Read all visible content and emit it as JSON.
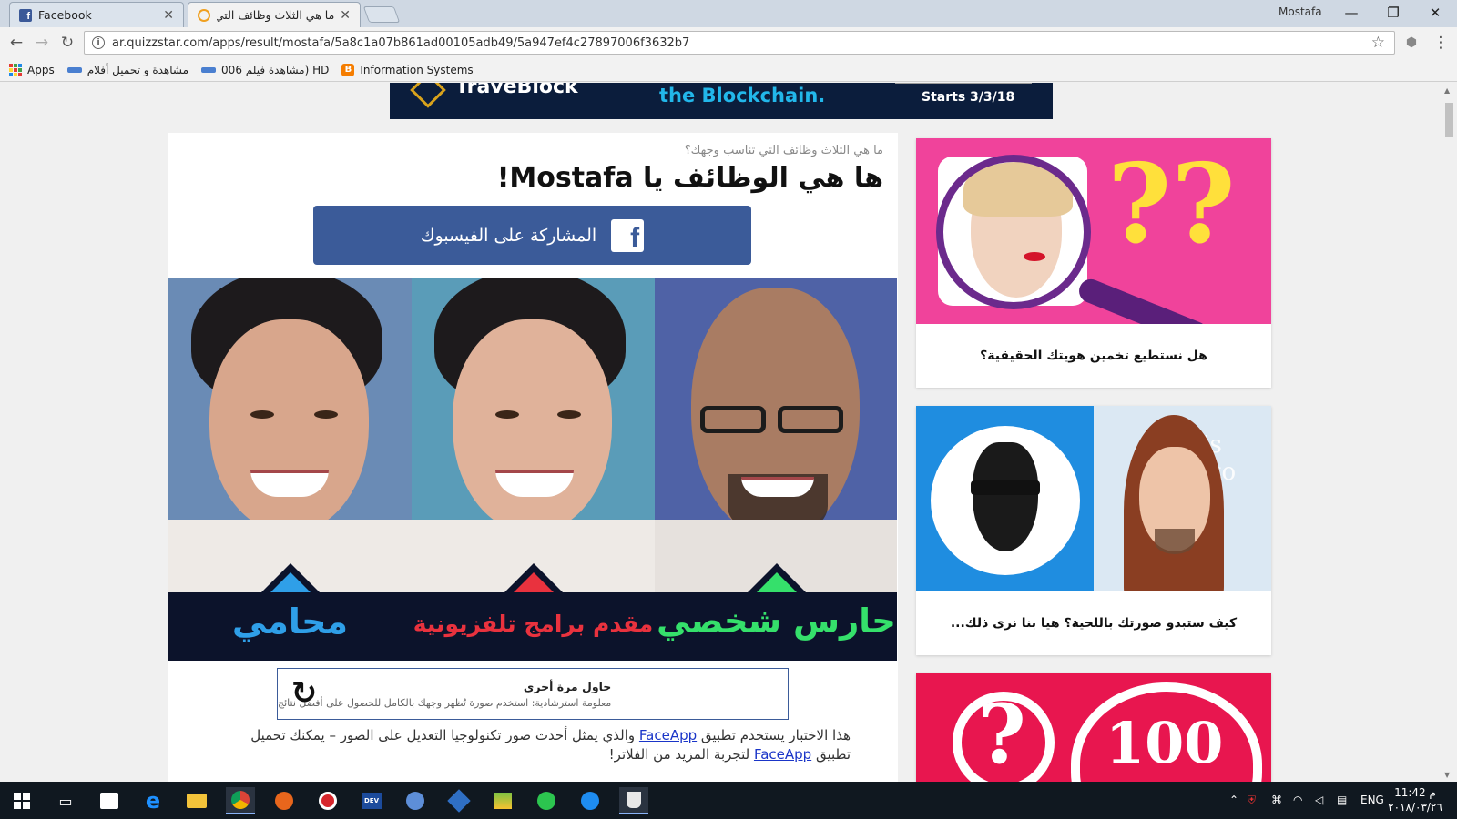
{
  "tabs": [
    {
      "title": "Facebook",
      "active": false
    },
    {
      "title": "ما هي الثلاث وظائف التي",
      "active": true
    }
  ],
  "window": {
    "user": "Mostafa"
  },
  "address": {
    "url": "ar.quizzstar.com/apps/result/mostafa/5a8c1a07b861ad00105adb49/5a947ef4c27897006f3632b7"
  },
  "bookmarks": [
    {
      "label": "Apps",
      "icon": "apps-grid-icon"
    },
    {
      "label": "مشاهدة و تحميل أفلام",
      "icon": "site-icon"
    },
    {
      "label": "مشاهدة فيلم 006) HD",
      "icon": "site-icon"
    },
    {
      "label": "Information Systems",
      "icon": "blogger-icon"
    }
  ],
  "banner": {
    "brand": "TraveBlock",
    "tagline": "the Blockchain.",
    "starts": "Starts 3/3/18"
  },
  "quiz": {
    "subtitle": "ما هي الثلاث وظائف التي تناسب وجهك؟",
    "headline": "ها هي الوظائف يا Mostafa!",
    "share_label": "المشاركة على الفيسبوك",
    "jobs": [
      {
        "label": "حارس شخصي",
        "color": "#35e06b"
      },
      {
        "label": "مقدم برامج تلفزيونية",
        "color": "#e9323e"
      },
      {
        "label": "محامي",
        "color": "#2f9fe8"
      }
    ],
    "try_again_title": "حاول مرة أخرى",
    "try_again_hint": "معلومة استرشادية: استخدم صورة تُظهر وجهك بالكامل للحصول على أفضل نتائج",
    "desc_part1": "هذا الاختبار يستخدم تطبيق ",
    "desc_link1": "FaceApp",
    "desc_part2": " والذي يمثل أحدث صور تكنولوجيا التعديل على الصور – يمكنك تحميل تطبيق ",
    "desc_link2": "FaceApp",
    "desc_part3": " لتجربة المزيد من الفلاتر!"
  },
  "sidebar": [
    {
      "caption": "هل نستطيع تخمين هويتك الحقيقية؟",
      "bg": "#f0439b"
    },
    {
      "caption": "كيف ستبدو صورتك باللحية؟ هيا بنا نرى ذلك...",
      "bg": "#1f8de0",
      "overlay_text": "e's into"
    },
    {
      "caption": "",
      "bg": "#e8164f",
      "number": "100"
    }
  ],
  "taskbar": {
    "lang": "ENG",
    "time": "11:42 م",
    "date": "٢٠١٨/٠٣/٢٦"
  }
}
